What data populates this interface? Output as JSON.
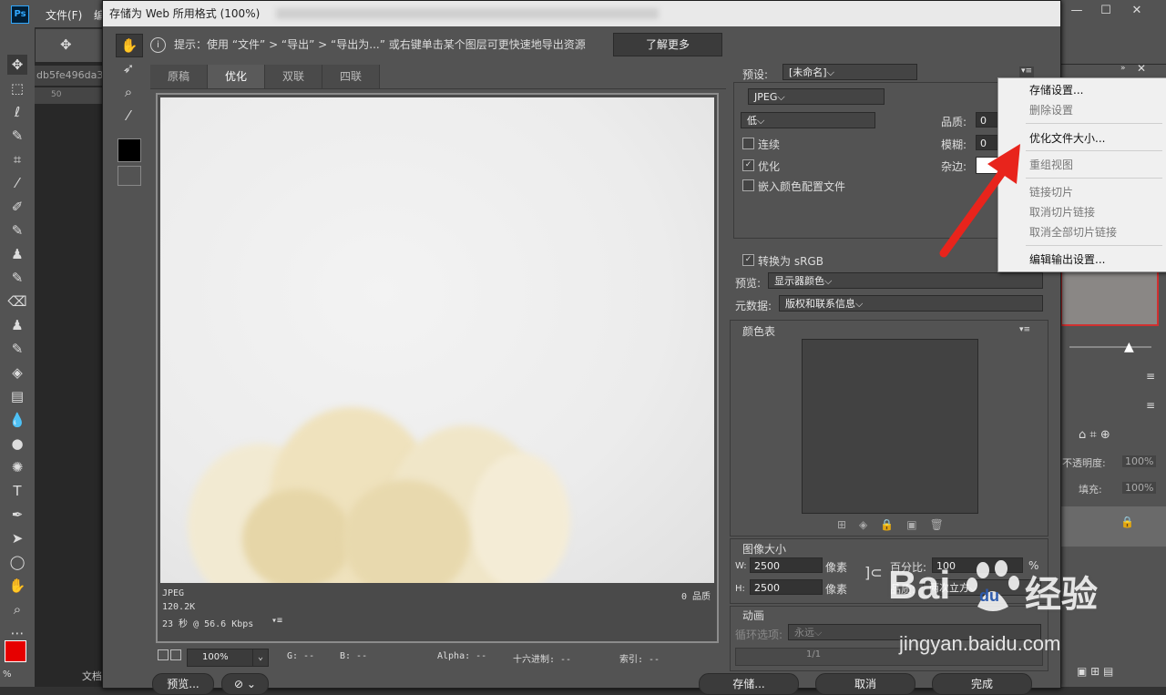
{
  "photoshop": {
    "logo": "Ps",
    "menu": [
      "文件(F)",
      "编"
    ],
    "doc_tab": "db5fe496da3",
    "ruler_tick": "50",
    "opacity_label": "不透明度:",
    "opacity_value": "100%",
    "fill_label": "填充:",
    "fill_value": "100%",
    "bottom_left": "%",
    "bottom_doc": "文档"
  },
  "dialog": {
    "title": "存储为 Web 所用格式 (100%)",
    "hint": "提示：使用 “文件” > “导出” > “导出为...” 或右键单击某个图层可更快速地导出资源",
    "learn_more": "了解更多",
    "tabs": [
      "原稿",
      "优化",
      "双联",
      "四联"
    ],
    "active_tab": "优化",
    "preview_info": {
      "format": "JPEG",
      "size": "120.2K",
      "speed": "23 秒 @ 56.6 Kbps",
      "quality": "0 品质"
    },
    "status": {
      "zoom": "100%",
      "g": "G: --",
      "b": "B: --",
      "alpha": "Alpha: --",
      "hex": "十六进制: --",
      "index": "索引: --"
    },
    "buttons": {
      "preview": "预览...",
      "save": "存储...",
      "cancel": "取消",
      "done": "完成"
    }
  },
  "settings": {
    "preset_label": "预设:",
    "preset_value": "[未命名]",
    "format": "JPEG",
    "quality_level": "低",
    "quality_label": "品质:",
    "quality_value": "0",
    "blur_label": "模糊:",
    "blur_value": "0",
    "matte_label": "杂边:",
    "progressive": {
      "label": "连续",
      "checked": false
    },
    "optimized": {
      "label": "优化",
      "checked": true
    },
    "embed_profile": {
      "label": "嵌入颜色配置文件",
      "checked": false
    },
    "convert_srgb": {
      "label": "转换为 sRGB",
      "checked": true
    },
    "preview_label": "预览:",
    "preview_value": "显示器颜色",
    "metadata_label": "元数据:",
    "metadata_value": "版权和联系信息",
    "color_table_title": "颜色表",
    "image_size_title": "图像大小",
    "w_label": "W:",
    "w_value": "2500",
    "h_label": "H:",
    "h_value": "2500",
    "px_unit": "像素",
    "percent_label": "百分比:",
    "percent_value": "100",
    "percent_unit": "%",
    "resample_label": "品质:",
    "resample_value": "两次立方",
    "animation_title": "动画",
    "loop_label": "循环选项:",
    "loop_value": "永远",
    "frame_counter": "1/1"
  },
  "context_menu": {
    "items": [
      {
        "label": "存储设置...",
        "enabled": true
      },
      {
        "label": "删除设置",
        "enabled": false
      },
      {
        "label": "优化文件大小...",
        "enabled": true
      },
      {
        "label": "重组视图",
        "enabled": false
      },
      {
        "label": "链接切片",
        "enabled": false
      },
      {
        "label": "取消切片链接",
        "enabled": false
      },
      {
        "label": "取消全部切片链接",
        "enabled": false
      },
      {
        "label": "编辑输出设置...",
        "enabled": true
      }
    ]
  },
  "watermark": {
    "brand": "Bai",
    "brand_du": "du",
    "experience": "经验",
    "url": "jingyan.baidu.com"
  },
  "colors": {
    "arrow": "#e8241c",
    "foreground": "#e60000",
    "ps_blue": "#31a8ff"
  }
}
